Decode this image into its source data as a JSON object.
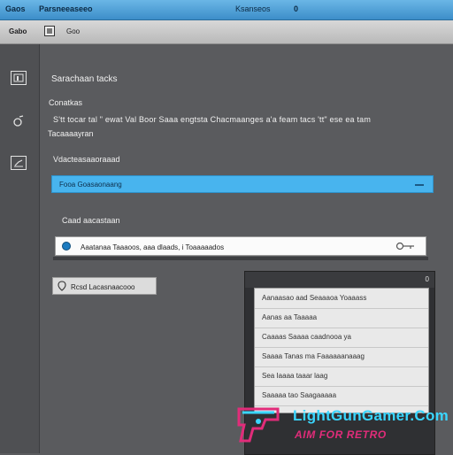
{
  "titlebar": {
    "app": "Gaos",
    "tab": "Parsneeaseeo",
    "center": "Ksanseos",
    "badge": "0"
  },
  "toolbar": {
    "label_left": "Gabo",
    "label_right": "Goo"
  },
  "sidebar": {
    "icons": [
      "image-icon",
      "settings-icon",
      "chart-icon"
    ]
  },
  "content": {
    "heading": "Sarachaan tacks",
    "subheading": "Conatkas",
    "para1": "S'tt tocar tal \" ewat Val Boor Saaa engtsta Chacmaanges a'a feam tacs 'tt\"   ese   ea tam",
    "para2": "Tacaaaayran",
    "section1": "Vdacteasaaoraaad"
  },
  "select": {
    "label": "Fooa Goasaonaang",
    "caret": "-"
  },
  "section2": "Caad aacastaan",
  "search": {
    "value": "Aaatanaa Taaaoos, aaa dlaads, i Toaaaaados"
  },
  "button": {
    "label": "Rcsd Lacasnaacooo"
  },
  "dropdown": {
    "badge": "0",
    "items": [
      "Aanaasao aad  Seaaaoa Yoaaass",
      "Aanas aa Taaaaa",
      "Caaaas Saaaa caadnooa ya",
      "Saaaa Tanas ma Faaaaaanaaag",
      "Sea Iaaaa taaar laag",
      "Saaaaa tao Saagaaaaa"
    ]
  },
  "watermark": {
    "title": "LightGunGamer.Com",
    "subtitle": "AIM FOR RETRO"
  },
  "colors": {
    "accent": "#48b4ee",
    "watermark_blue": "#3ad6ff",
    "watermark_pink": "#e12c7a"
  }
}
